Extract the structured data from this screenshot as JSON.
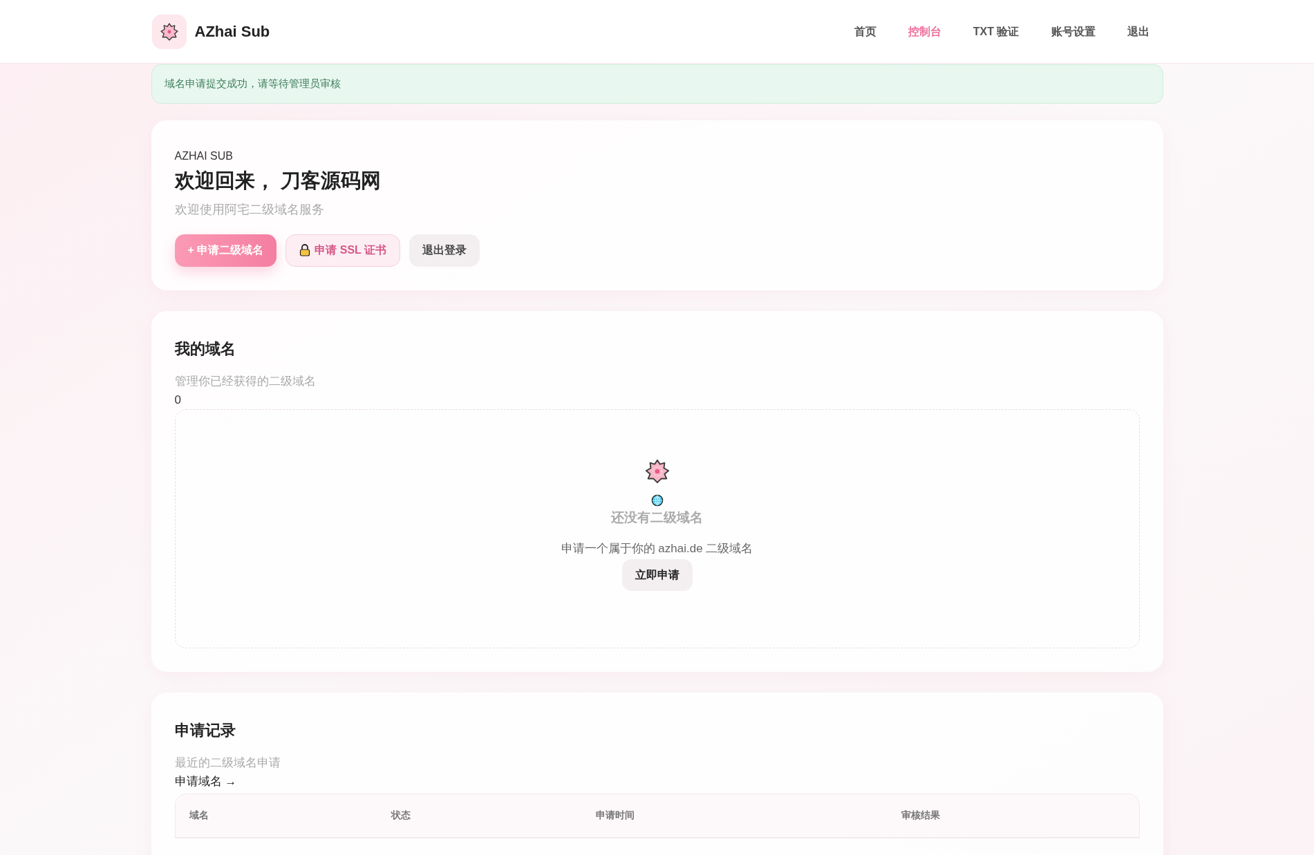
{
  "brand": {
    "name": "AZhai Sub"
  },
  "nav": [
    {
      "label": "首页",
      "selected": false
    },
    {
      "label": "控制台",
      "selected": true
    },
    {
      "label": "TXT 验证",
      "selected": false
    },
    {
      "label": "账号设置",
      "selected": false
    },
    {
      "label": "退出",
      "selected": false
    }
  ],
  "alert": {
    "text": "域名申请提交成功，请等待管理员审核"
  },
  "hero": {
    "eyebrow": "AZHAI SUB",
    "title": "欢迎回来， 刀客源码网",
    "subtitle": "欢迎使用阿宅二级域名服务",
    "buttons": [
      {
        "kind": "primary",
        "label": "+ 申请二级域名"
      },
      {
        "kind": "ssl",
        "label": "申请 SSL 证书"
      },
      {
        "kind": "plain",
        "label": "退出登录"
      }
    ]
  },
  "domains": {
    "title": "我的域名",
    "subtitle": "管理你已经获得的二级域名",
    "count": "0",
    "empty": {
      "title": "还没有二级域名",
      "text": "申请一个属于你的 azhai.de 二级域名",
      "button": "立即申请"
    }
  },
  "records": {
    "title": "申请记录",
    "subtitle": "最近的二级域名申请",
    "link": "申请域名 →",
    "columns": [
      "域名",
      "状态",
      "申请时间",
      "审核结果"
    ]
  }
}
